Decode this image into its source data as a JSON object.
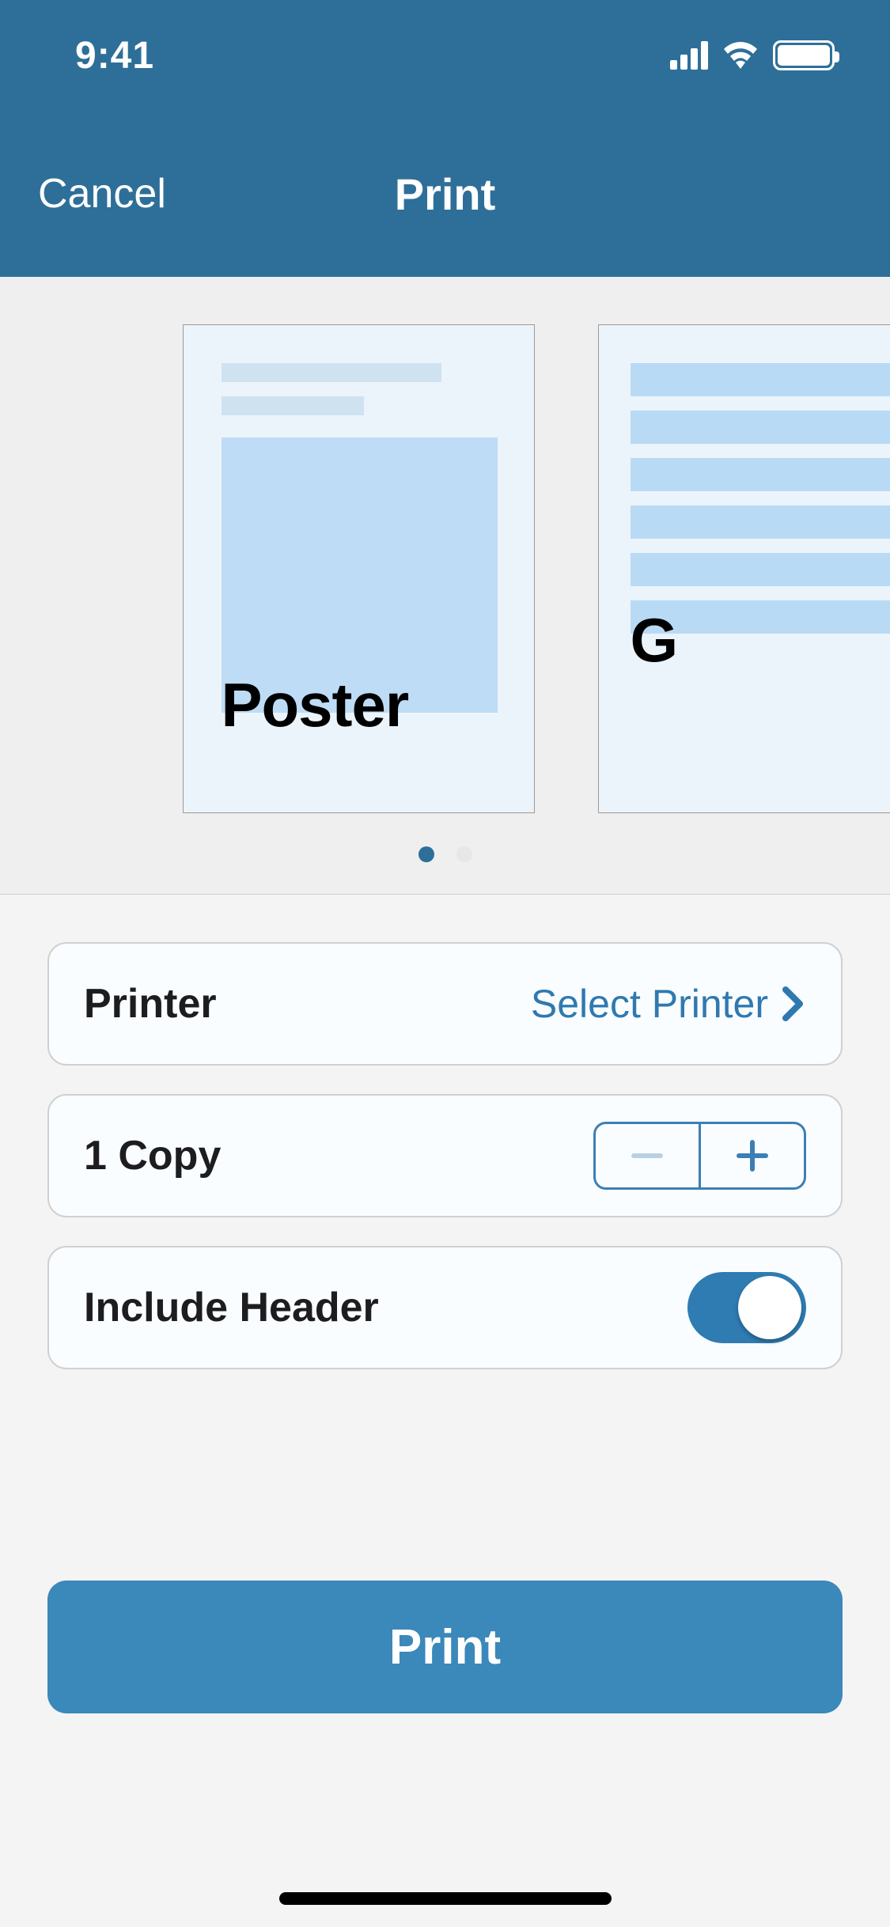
{
  "status_bar": {
    "time": "9:41"
  },
  "nav": {
    "cancel": "Cancel",
    "title": "Print"
  },
  "preview": {
    "cards": [
      {
        "label": "Poster"
      },
      {
        "label": "G"
      }
    ],
    "active_page": 0
  },
  "settings": {
    "printer": {
      "label": "Printer",
      "value": "Select Printer"
    },
    "copies": {
      "label": "1 Copy"
    },
    "include_header": {
      "label": "Include Header",
      "on": true
    }
  },
  "primary_action": "Print"
}
